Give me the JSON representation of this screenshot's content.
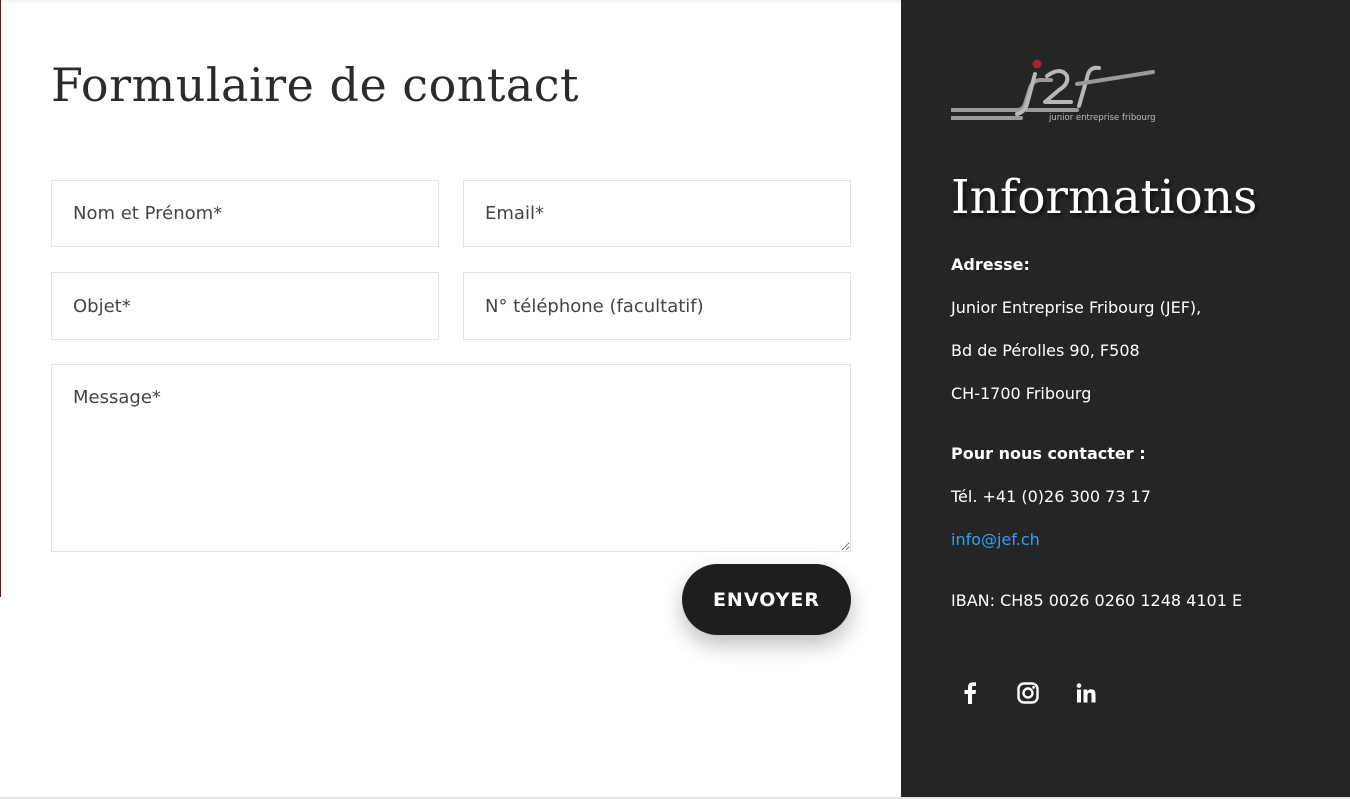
{
  "form": {
    "title": "Formulaire de contact",
    "fields": {
      "name_placeholder": "Nom et Prénom*",
      "email_placeholder": "Email*",
      "subject_placeholder": "Objet*",
      "phone_placeholder": "N° téléphone (facultatif)",
      "message_placeholder": "Message*"
    },
    "submit_label": "ENVOYER"
  },
  "info": {
    "logo_text": "junior entreprise fribourg",
    "title": "Informations",
    "address_label": "Adresse:",
    "address_line1": "Junior Entreprise Fribourg (JEF),",
    "address_line2": "Bd de Pérolles 90, F508",
    "address_line3": "CH-1700 Fribourg",
    "contact_label": "Pour nous contacter :",
    "phone": "Tél. +41 (0)26 300 73 17",
    "email": "info@jef.ch",
    "iban": "IBAN: CH85 0026 0260 1248 4101 E",
    "social": [
      "facebook-icon",
      "instagram-icon",
      "linkedin-icon"
    ]
  },
  "colors": {
    "panel_bg": "#252525",
    "button_bg": "#1e1e1e",
    "link": "#2ea3f2",
    "logo_accent": "#a3252c"
  }
}
